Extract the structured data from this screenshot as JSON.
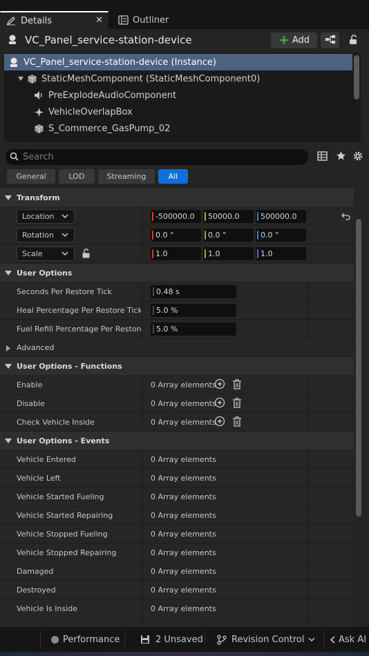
{
  "tabs": {
    "details": "Details",
    "outliner": "Outliner"
  },
  "actor": {
    "name": "VC_Panel_service-station-device",
    "add_label": "Add"
  },
  "tree": [
    {
      "label": "VC_Panel_service-station-device (Instance)",
      "icon": "actor-icon",
      "indent": 0,
      "selected": true
    },
    {
      "label": "StaticMeshComponent (StaticMeshComponent0)",
      "icon": "cube-icon",
      "indent": 1,
      "selected": false
    },
    {
      "label": "PreExplodeAudioComponent",
      "icon": "speaker-icon",
      "indent": 2,
      "selected": false
    },
    {
      "label": "VehicleOverlapBox",
      "icon": "collision-icon",
      "indent": 2,
      "selected": false
    },
    {
      "label": "S_Commerce_GasPump_02",
      "icon": "cube-icon",
      "indent": 2,
      "selected": false
    }
  ],
  "search": {
    "placeholder": "Search"
  },
  "filters": [
    "General",
    "LOD",
    "Streaming",
    "All"
  ],
  "active_filter": "All",
  "transform": {
    "title": "Transform",
    "location": {
      "label": "Location",
      "x": "-500000.0",
      "y": "50000.0",
      "z": "500000.0"
    },
    "rotation": {
      "label": "Rotation",
      "x": "0.0 °",
      "y": "0.0 °",
      "z": "0.0 °"
    },
    "scale": {
      "label": "Scale",
      "x": "1.0",
      "y": "1.0",
      "z": "1.0"
    }
  },
  "user_options": {
    "title": "User Options",
    "rows": [
      {
        "label": "Seconds Per Restore Tick",
        "value": "0.48 s"
      },
      {
        "label": "Heal Percentage Per Restore Tick",
        "value": "5.0 %"
      },
      {
        "label": "Fuel Refill Percentage Per Restore...",
        "value": "5.0 %"
      }
    ],
    "advanced": "Advanced"
  },
  "functions": {
    "title": "User Options - Functions",
    "rows": [
      {
        "label": "Enable",
        "value": "0 Array elements"
      },
      {
        "label": "Disable",
        "value": "0 Array elements"
      },
      {
        "label": "Check Vehicle Inside",
        "value": "0 Array elements"
      }
    ]
  },
  "events": {
    "title": "User Options - Events",
    "rows": [
      {
        "label": "Vehicle Entered",
        "value": "0 Array elements"
      },
      {
        "label": "Vehicle Left",
        "value": "0 Array elements"
      },
      {
        "label": "Vehicle Started Fueling",
        "value": "0 Array elements"
      },
      {
        "label": "Vehicle Started Repairing",
        "value": "0 Array elements"
      },
      {
        "label": "Vehicle Stopped Fueling",
        "value": "0 Array elements"
      },
      {
        "label": "Vehicle Stopped Repairing",
        "value": "0 Array elements"
      },
      {
        "label": "Damaged",
        "value": "0 Array elements"
      },
      {
        "label": "Destroyed",
        "value": "0 Array elements"
      },
      {
        "label": "Vehicle Is Inside",
        "value": "0 Array elements"
      }
    ]
  },
  "statusbar": {
    "performance": "Performance",
    "unsaved": "2 Unsaved",
    "revision": "Revision Control",
    "ask_ai": "Ask AI"
  },
  "colors": {
    "accent": "#0f6edb",
    "selection": "#4d6180",
    "axis_x": "#d43a3a",
    "axis_y": "#7fc12f",
    "axis_z": "#2f7fe0",
    "add_plus": "#3fb43f"
  }
}
